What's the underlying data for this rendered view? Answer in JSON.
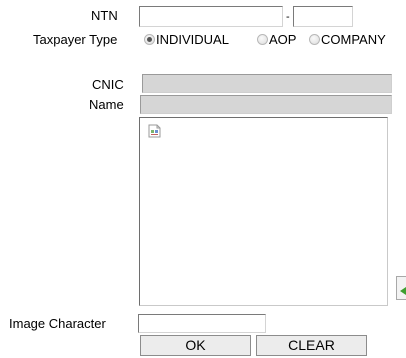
{
  "ntn": {
    "label": "NTN",
    "value_main": "",
    "value_suffix": "",
    "separator": "-"
  },
  "taxpayer_type": {
    "label": "Taxpayer Type",
    "options": [
      {
        "label": "INDIVIDUAL",
        "checked": true
      },
      {
        "label": "AOP",
        "checked": false
      },
      {
        "label": "COMPANY",
        "checked": false
      }
    ]
  },
  "cnic": {
    "label": "CNIC",
    "value": ""
  },
  "name": {
    "label": "Name",
    "value": ""
  },
  "captcha": {
    "image_icon": "broken-image-icon",
    "refresh_icon": "refresh-arrow-icon"
  },
  "image_character": {
    "label": "Image Character",
    "value": ""
  },
  "buttons": {
    "ok": "OK",
    "clear": "CLEAR"
  }
}
